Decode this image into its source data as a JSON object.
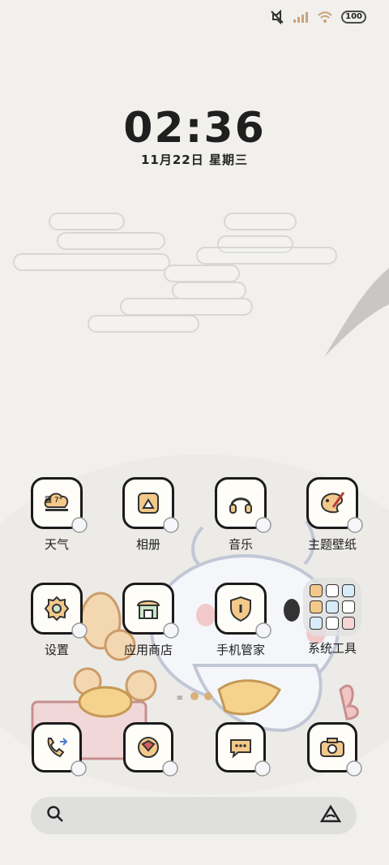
{
  "status_bar": {
    "battery": "100",
    "icons": [
      "mute-icon",
      "signal-icon",
      "wifi-icon",
      "battery-icon"
    ]
  },
  "clock": {
    "time": "02:36",
    "date": "11月22日 星期三"
  },
  "home": {
    "row1": [
      {
        "label": "天气",
        "icon": "weather-icon",
        "weather_text": "霾 7°"
      },
      {
        "label": "相册",
        "icon": "gallery-icon"
      },
      {
        "label": "音乐",
        "icon": "music-icon"
      },
      {
        "label": "主题壁纸",
        "icon": "theme-icon"
      }
    ],
    "row2": [
      {
        "label": "设置",
        "icon": "settings-icon"
      },
      {
        "label": "应用商店",
        "icon": "store-icon"
      },
      {
        "label": "手机管家",
        "icon": "security-icon"
      },
      {
        "label": "系统工具",
        "icon": "folder-icon"
      }
    ]
  },
  "dock": [
    {
      "icon": "phone-icon"
    },
    {
      "icon": "browser-icon"
    },
    {
      "icon": "messages-icon"
    },
    {
      "icon": "camera-icon"
    }
  ],
  "colors": {
    "accent": "#f3c98b",
    "outline": "#1b1b1b",
    "background": "#f1f0ed"
  }
}
